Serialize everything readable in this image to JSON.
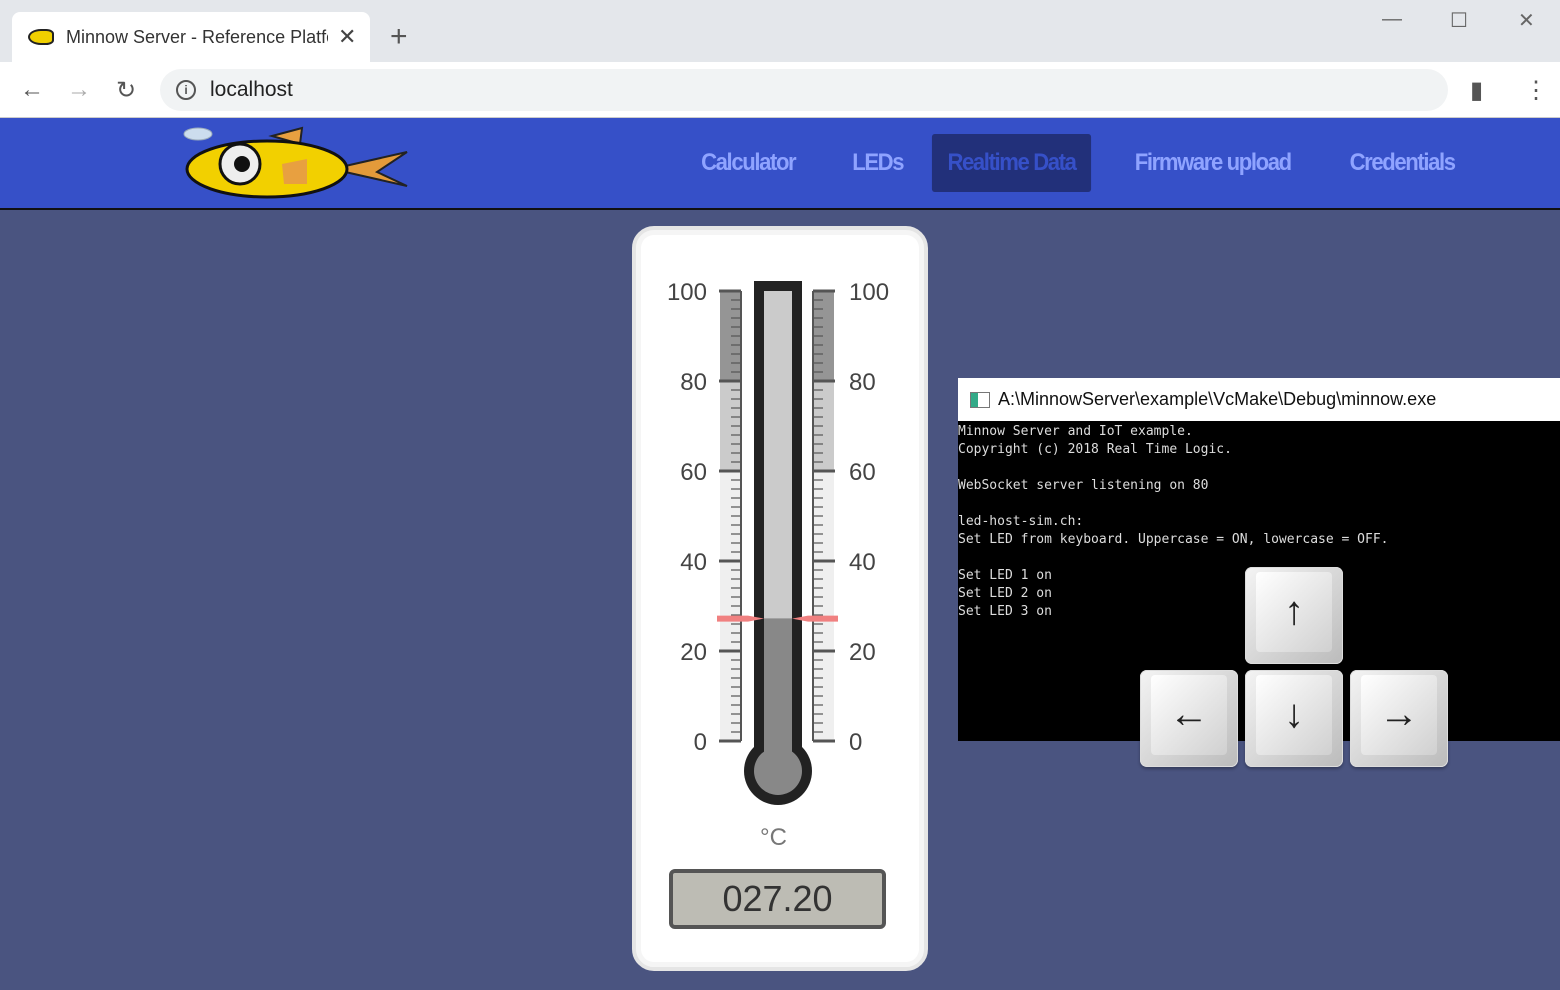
{
  "browser": {
    "tab_title": "Minnow Server - Reference Platform",
    "url": "localhost"
  },
  "nav": {
    "items": [
      "Calculator",
      "LEDs",
      "Realtime Data",
      "Firmware upload",
      "Credentials"
    ],
    "active": "Realtime Data"
  },
  "thermometer": {
    "min": 0,
    "max": 100,
    "labels": [
      "100",
      "80",
      "60",
      "40",
      "20",
      "0"
    ],
    "value": 27.2,
    "unit": "°C",
    "readout": "027.20"
  },
  "console": {
    "title": "A:\\MinnowServer\\example\\VcMake\\Debug\\minnow.exe",
    "lines": [
      "Minnow Server and IoT example.",
      "Copyright (c) 2018 Real Time Logic.",
      "",
      "WebSocket server listening on 80",
      "",
      "led-host-sim.ch:",
      "Set LED from keyboard. Uppercase = ON, lowercase = OFF.",
      "",
      "Set LED 1 on",
      "Set LED 2 on",
      "Set LED 3 on"
    ]
  },
  "keys": {
    "up": "↑",
    "left": "←",
    "down": "↓",
    "right": "→"
  }
}
